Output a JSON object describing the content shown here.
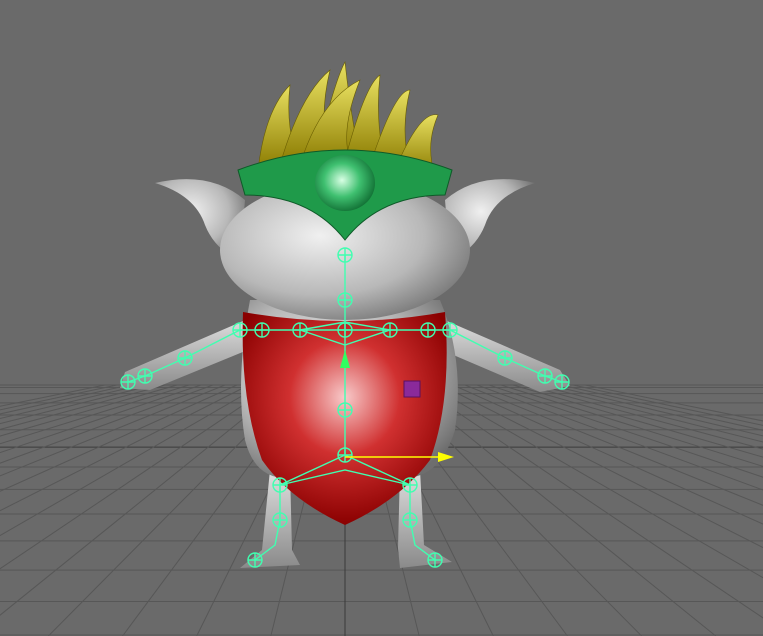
{
  "viewport": {
    "background_color": "#6a6a6a",
    "grid_color": "#555555",
    "grid_axis_color": "#3a3a3a"
  },
  "character": {
    "skin_color": "#bdbdbd",
    "crown_color": "#1f9a4a",
    "hair_color": "#b8a800",
    "shield_color": "#b00a0a",
    "skeleton_color": "#40ffb0"
  },
  "manipulator": {
    "translate_arrow_color": "#ffff00",
    "locator_color": "#8a2a9a"
  }
}
